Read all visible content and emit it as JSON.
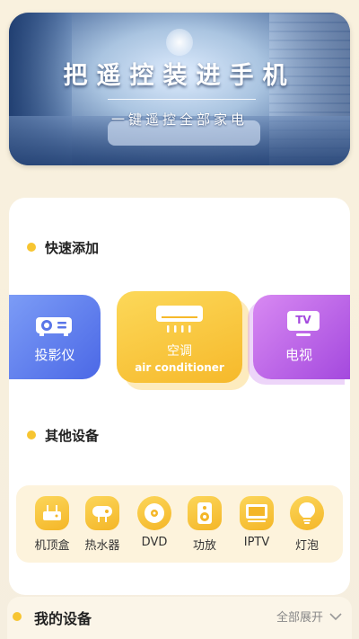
{
  "banner": {
    "title": "把遥控装进手机",
    "subtitle": "一键遥控全部家电"
  },
  "quick_add": {
    "title": "快速添加",
    "tiles": [
      {
        "label": "投影仪",
        "icon": "projector-icon"
      },
      {
        "label": "空调",
        "sublabel": "air conditioner",
        "icon": "air-conditioner-icon"
      },
      {
        "label": "电视",
        "icon": "tv-icon",
        "icon_text": "TV"
      }
    ]
  },
  "other_devices": {
    "title": "其他设备",
    "items": [
      {
        "label": "机顶盒",
        "icon": "set-top-box-icon"
      },
      {
        "label": "热水器",
        "icon": "water-heater-icon"
      },
      {
        "label": "DVD",
        "icon": "dvd-icon"
      },
      {
        "label": "功放",
        "icon": "speaker-icon"
      },
      {
        "label": "IPTV",
        "icon": "iptv-icon"
      },
      {
        "label": "灯泡",
        "icon": "bulb-icon"
      }
    ]
  },
  "my_devices": {
    "title": "我的设备",
    "expand_label": "全部展开"
  },
  "colors": {
    "accent": "#f7c531",
    "projector": "#4b68e6",
    "ac": "#f6b92b",
    "tv": "#a449de",
    "background": "#f7eedb"
  }
}
